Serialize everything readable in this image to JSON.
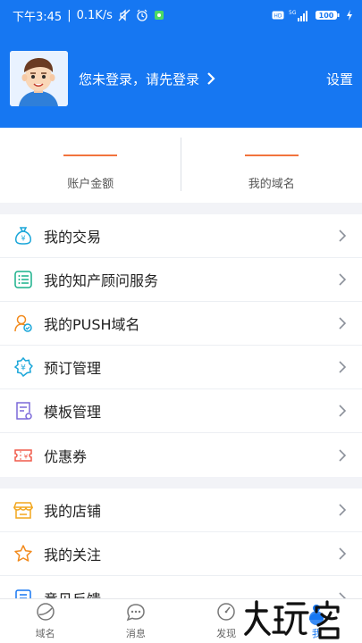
{
  "statusbar": {
    "time": "下午3:45",
    "speed": "0.1K/s",
    "network": "5G",
    "battery": "100"
  },
  "profile": {
    "login_text": "您未登录，请先登录",
    "settings_label": "设置"
  },
  "tiles": [
    {
      "label": "账户金额"
    },
    {
      "label": "我的域名"
    }
  ],
  "section1": [
    {
      "label": "我的交易",
      "icon": "money-bag-icon",
      "color": "#1aa6d9"
    },
    {
      "label": "我的知产顾问服务",
      "icon": "list-icon",
      "color": "#19b08a"
    },
    {
      "label": "我的PUSH域名",
      "icon": "user-push-icon",
      "color": "#f28a1c"
    },
    {
      "label": "预订管理",
      "icon": "reservation-icon",
      "color": "#1aa6d9"
    },
    {
      "label": "模板管理",
      "icon": "template-icon",
      "color": "#7b68d9"
    },
    {
      "label": "优惠券",
      "icon": "coupon-icon",
      "color": "#f05a4a"
    }
  ],
  "section2": [
    {
      "label": "我的店铺",
      "icon": "store-icon",
      "color": "#f2a61c"
    },
    {
      "label": "我的关注",
      "icon": "star-icon",
      "color": "#f28a1c"
    },
    {
      "label": "意见反馈",
      "icon": "feedback-icon",
      "color": "#1677f2"
    }
  ],
  "tabbar": [
    {
      "label": "域名",
      "icon": "domain-icon"
    },
    {
      "label": "消息",
      "icon": "message-icon"
    },
    {
      "label": "发现",
      "icon": "discover-icon"
    },
    {
      "label": "我",
      "icon": "me-icon",
      "active": true
    }
  ],
  "watermark": "大玩客"
}
